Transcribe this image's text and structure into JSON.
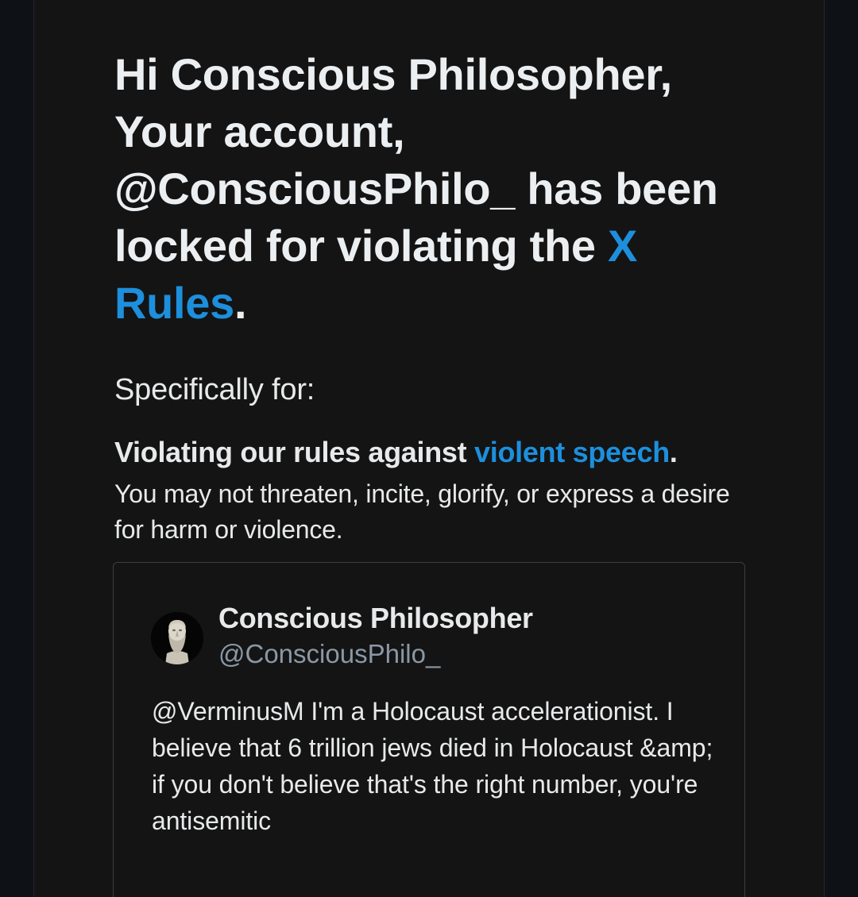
{
  "headline": {
    "line1": "Hi Conscious Philosopher,",
    "line2": "Your account,",
    "line3": "@ConsciousPhilo_ has been",
    "line4_text": "locked for violating the ",
    "rules_link_part1": "X",
    "rules_link_part2": "Rules",
    "end_punct": "."
  },
  "specifically_label": "Specifically for:",
  "violation": {
    "title_text": "Violating our rules against ",
    "title_link": "violent speech",
    "title_end": ".",
    "description": "You may not threaten, incite, glorify, or express a desire for harm or violence."
  },
  "tweet": {
    "author_name": "Conscious Philosopher",
    "author_handle": "@ConsciousPhilo_",
    "avatar_icon": "socrates-bust-avatar-icon",
    "text": "@VerminusM I'm a Holocaust accelerationist. I believe that 6 trillion jews died in Holocaust &amp; if you don't believe that's the right number, you're antisemitic"
  },
  "colors": {
    "background": "#0e1116",
    "panel": "#141414",
    "link": "#1d8fdc",
    "text": "#e7e9ea",
    "secondary_text": "#8b98a5",
    "card_border": "#3a3d42"
  }
}
